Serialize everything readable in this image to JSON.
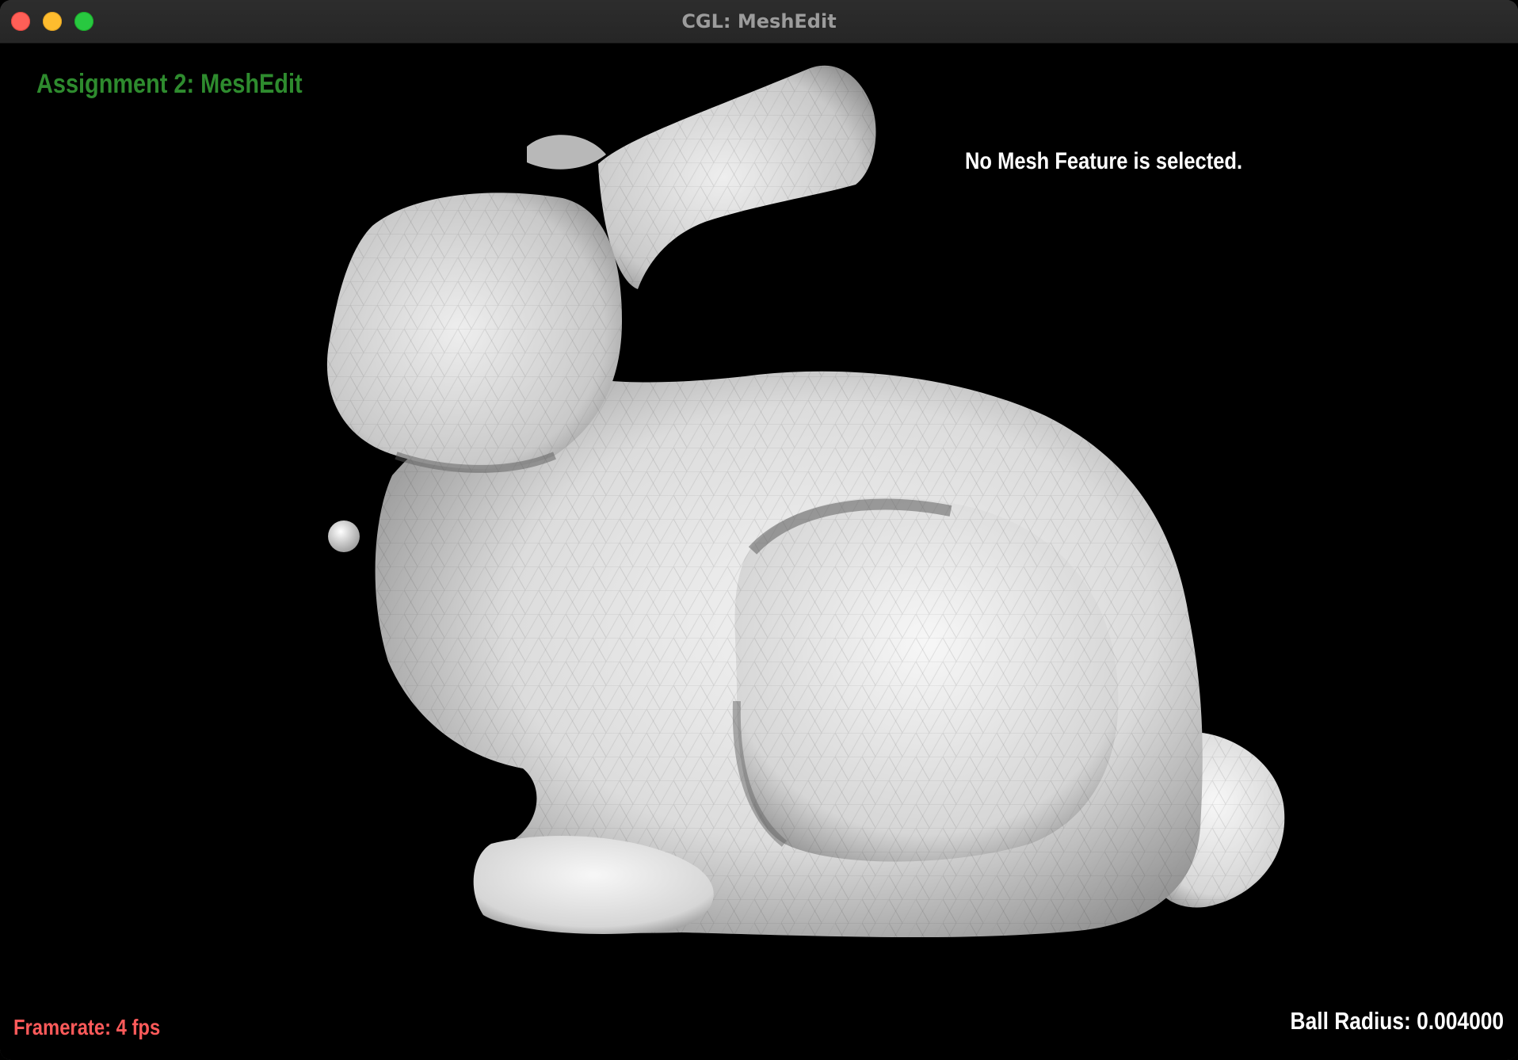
{
  "window": {
    "title": "CGL: MeshEdit"
  },
  "overlay": {
    "assignment_title": "Assignment 2: MeshEdit",
    "feature_status": "No Mesh Feature is selected.",
    "framerate": "Framerate: 4 fps",
    "ball_radius": "Ball Radius: 0.004000"
  },
  "colors": {
    "background": "#000000",
    "assignment_title": "#2e8b2e",
    "framerate": "#ff5a5a",
    "status_text": "#ffffff",
    "mesh_light": "#f2f2f2",
    "mesh_shadow": "#6a6a6a"
  },
  "icons": {
    "close": "close-icon",
    "minimize": "minimize-icon",
    "maximize": "maximize-icon"
  }
}
